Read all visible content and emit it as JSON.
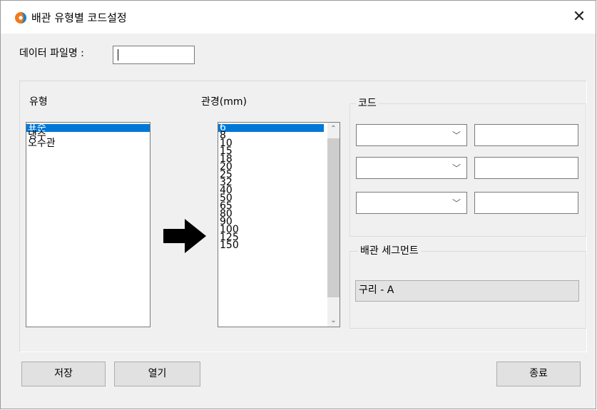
{
  "window": {
    "title": "배관 유형별 코드설정"
  },
  "file": {
    "label": "데이터 파일명 :",
    "value": ""
  },
  "type_list": {
    "label": "유형",
    "items": [
      "표준",
      "냉수",
      "오수관"
    ],
    "selected_index": 0
  },
  "diameter_list": {
    "label": "관경(mm)",
    "items": [
      "6",
      "8",
      "10",
      "15",
      "18",
      "20",
      "25",
      "32",
      "40",
      "50",
      "65",
      "80",
      "90",
      "100",
      "125",
      "150"
    ],
    "selected_index": 0
  },
  "code_group": {
    "label": "코드",
    "rows": [
      {
        "combo_value": "",
        "text_value": ""
      },
      {
        "combo_value": "",
        "text_value": ""
      },
      {
        "combo_value": "",
        "text_value": ""
      }
    ]
  },
  "segment_group": {
    "label": "배관 세그먼트",
    "value": "구리 - A"
  },
  "buttons": {
    "save": "저장",
    "open": "열기",
    "exit": "종료"
  },
  "colors": {
    "selection": "#0078d7",
    "arrow": "#000000"
  }
}
